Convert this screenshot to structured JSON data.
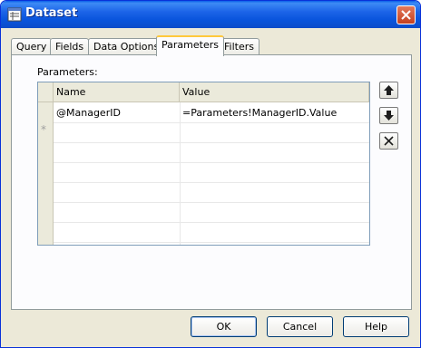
{
  "window": {
    "title": "Dataset"
  },
  "tabs": [
    {
      "label": "Query"
    },
    {
      "label": "Fields"
    },
    {
      "label": "Data Options"
    },
    {
      "label": "Parameters",
      "active": true
    },
    {
      "label": "Filters"
    }
  ],
  "parameters": {
    "group_label": "Parameters:",
    "columns": {
      "name": "Name",
      "value": "Value"
    },
    "rows": [
      {
        "name": "@ManagerID",
        "value": "=Parameters!ManagerID.Value"
      }
    ],
    "new_row_marker": "*"
  },
  "side_buttons": [
    {
      "icon": "arrow-up-icon",
      "action": "move-up"
    },
    {
      "icon": "arrow-down-icon",
      "action": "move-down"
    },
    {
      "icon": "delete-x-icon",
      "action": "delete"
    }
  ],
  "buttons": {
    "ok": "OK",
    "cancel": "Cancel",
    "help": "Help"
  },
  "colors": {
    "titlebar": "#0954dc",
    "dialog_bg": "#ece9d8",
    "active_tab_accent": "#ffc83c"
  }
}
